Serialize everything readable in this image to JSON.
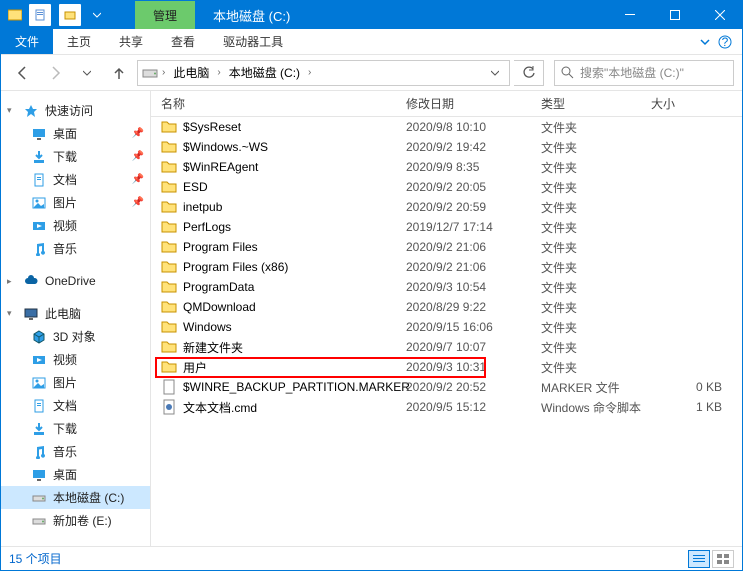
{
  "titlebar": {
    "contextual_tab": "管理",
    "title": "本地磁盘 (C:)"
  },
  "ribbon": {
    "file": "文件",
    "tabs": [
      "主页",
      "共享",
      "查看"
    ],
    "contextual": "驱动器工具"
  },
  "nav": {
    "breadcrumb": [
      "此电脑",
      "本地磁盘 (C:)"
    ],
    "search_placeholder": "搜索\"本地磁盘 (C:)\""
  },
  "sidebar": {
    "quick_access": "快速访问",
    "quick_items": [
      {
        "label": "桌面",
        "pin": true,
        "icon": "desktop"
      },
      {
        "label": "下载",
        "pin": true,
        "icon": "download"
      },
      {
        "label": "文档",
        "pin": true,
        "icon": "document"
      },
      {
        "label": "图片",
        "pin": true,
        "icon": "picture"
      },
      {
        "label": "视频",
        "pin": false,
        "icon": "video"
      },
      {
        "label": "音乐",
        "pin": false,
        "icon": "music"
      }
    ],
    "onedrive": "OneDrive",
    "this_pc": "此电脑",
    "pc_items": [
      {
        "label": "3D 对象",
        "icon": "3d"
      },
      {
        "label": "视频",
        "icon": "video"
      },
      {
        "label": "图片",
        "icon": "picture"
      },
      {
        "label": "文档",
        "icon": "document"
      },
      {
        "label": "下载",
        "icon": "download"
      },
      {
        "label": "音乐",
        "icon": "music"
      },
      {
        "label": "桌面",
        "icon": "desktop"
      },
      {
        "label": "本地磁盘 (C:)",
        "icon": "drive",
        "selected": true
      },
      {
        "label": "新加卷 (E:)",
        "icon": "drive"
      }
    ]
  },
  "columns": {
    "name": "名称",
    "date": "修改日期",
    "type": "类型",
    "size": "大小"
  },
  "rows": [
    {
      "name": "$SysReset",
      "date": "2020/9/8 10:10",
      "type": "文件夹",
      "size": "",
      "icon": "folder"
    },
    {
      "name": "$Windows.~WS",
      "date": "2020/9/2 19:42",
      "type": "文件夹",
      "size": "",
      "icon": "folder"
    },
    {
      "name": "$WinREAgent",
      "date": "2020/9/9 8:35",
      "type": "文件夹",
      "size": "",
      "icon": "folder"
    },
    {
      "name": "ESD",
      "date": "2020/9/2 20:05",
      "type": "文件夹",
      "size": "",
      "icon": "folder"
    },
    {
      "name": "inetpub",
      "date": "2020/9/2 20:59",
      "type": "文件夹",
      "size": "",
      "icon": "folder"
    },
    {
      "name": "PerfLogs",
      "date": "2019/12/7 17:14",
      "type": "文件夹",
      "size": "",
      "icon": "folder"
    },
    {
      "name": "Program Files",
      "date": "2020/9/2 21:06",
      "type": "文件夹",
      "size": "",
      "icon": "folder"
    },
    {
      "name": "Program Files (x86)",
      "date": "2020/9/2 21:06",
      "type": "文件夹",
      "size": "",
      "icon": "folder"
    },
    {
      "name": "ProgramData",
      "date": "2020/9/3 10:54",
      "type": "文件夹",
      "size": "",
      "icon": "folder"
    },
    {
      "name": "QMDownload",
      "date": "2020/8/29 9:22",
      "type": "文件夹",
      "size": "",
      "icon": "folder"
    },
    {
      "name": "Windows",
      "date": "2020/9/15 16:06",
      "type": "文件夹",
      "size": "",
      "icon": "folder"
    },
    {
      "name": "新建文件夹",
      "date": "2020/9/7 10:07",
      "type": "文件夹",
      "size": "",
      "icon": "folder"
    },
    {
      "name": "用户",
      "date": "2020/9/3 10:31",
      "type": "文件夹",
      "size": "",
      "icon": "folder",
      "highlight": true
    },
    {
      "name": "$WINRE_BACKUP_PARTITION.MARKER",
      "date": "2020/9/2 20:52",
      "type": "MARKER 文件",
      "size": "0 KB",
      "icon": "file"
    },
    {
      "name": "文本文档.cmd",
      "date": "2020/9/5 15:12",
      "type": "Windows 命令脚本",
      "size": "1 KB",
      "icon": "cmd"
    }
  ],
  "status": {
    "count": "15 个项目"
  }
}
